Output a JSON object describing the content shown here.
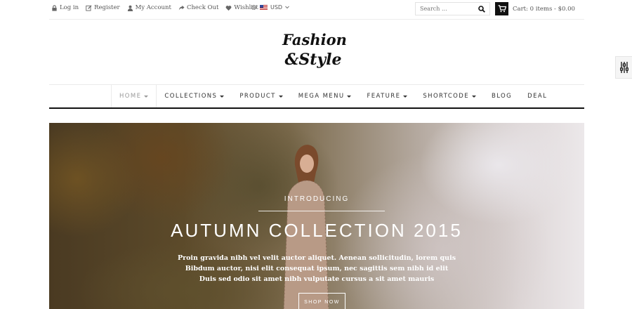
{
  "topbar": {
    "links": [
      {
        "label": "Log in",
        "icon": "lock-icon"
      },
      {
        "label": "Register",
        "icon": "edit-icon"
      },
      {
        "label": "My Account",
        "icon": "user-icon"
      },
      {
        "label": "Check Out",
        "icon": "share-icon"
      },
      {
        "label": "Wishlist",
        "icon": "heart-icon"
      }
    ],
    "currency": "USD",
    "search_placeholder": "Search ...",
    "cart_text": "Cart: 0 items - $0.00"
  },
  "logo": {
    "line1": "Fashion",
    "line2": "&Style"
  },
  "nav": {
    "items": [
      {
        "label": "HOME",
        "caret": true
      },
      {
        "label": "COLLECTIONS",
        "caret": true
      },
      {
        "label": "PRODUCT",
        "caret": true
      },
      {
        "label": "MEGA MENU",
        "caret": true
      },
      {
        "label": "FEATURE",
        "caret": true
      },
      {
        "label": "SHORTCODE",
        "caret": true
      },
      {
        "label": "BLOG",
        "caret": false
      },
      {
        "label": "DEAL",
        "caret": false
      }
    ]
  },
  "hero": {
    "intro": "INTRODUCING",
    "title": "AUTUMN COLLECTION 2015",
    "desc_line1": "Proin gravida nibh vel velit auctor aliquet. Aenean sollicitudin, lorem quis",
    "desc_line2": "Bibdum auctor, nisi elit consequat ipsum, nec sagittis sem nibh id elit",
    "desc_line3": "Duis sed odio sit amet nibh vulputate cursus a sit amet mauris",
    "button": "SHOP NOW"
  }
}
